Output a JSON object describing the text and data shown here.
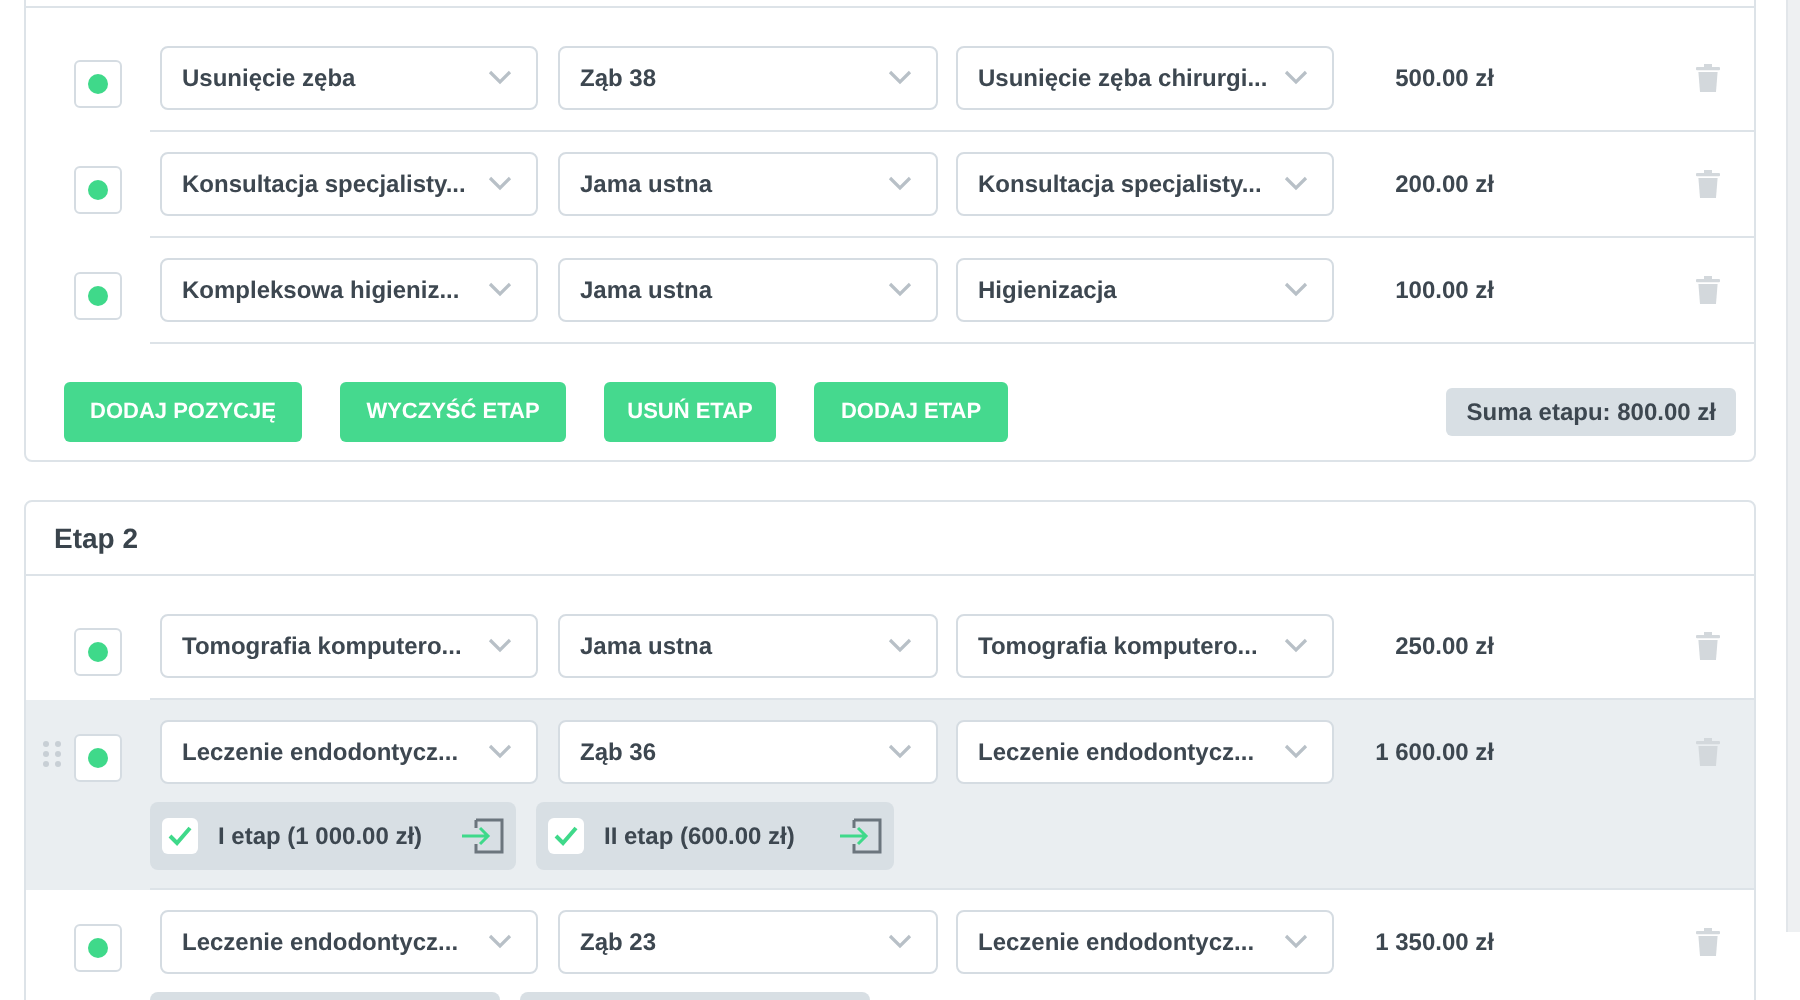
{
  "stages": [
    {
      "rows": [
        {
          "checked": true,
          "highlighted": false,
          "service": "Usunięcie zęba",
          "location": "Ząb 38",
          "variant": "Usunięcie zęba chirurgi...",
          "price": "500.00 zł"
        },
        {
          "checked": true,
          "highlighted": false,
          "service": "Konsultacja specjalisty...",
          "location": "Jama ustna",
          "variant": "Konsultacja specjalisty...",
          "price": "200.00 zł"
        },
        {
          "checked": true,
          "highlighted": false,
          "service": "Kompleksowa higieniz...",
          "location": "Jama ustna",
          "variant": "Higienizacja",
          "price": "100.00 zł"
        }
      ],
      "buttons": [
        "DODAJ POZYCJĘ",
        "WYCZYŚĆ ETAP",
        "USUŃ ETAP",
        "DODAJ ETAP"
      ],
      "total": "Suma etapu: 800.00 zł"
    },
    {
      "title": "Etap 2",
      "rows": [
        {
          "checked": true,
          "highlighted": false,
          "service": "Tomografia komputero...",
          "location": "Jama ustna",
          "variant": "Tomografia komputero...",
          "price": "250.00 zł"
        },
        {
          "checked": true,
          "highlighted": true,
          "service": "Leczenie endodontycz...",
          "location": "Ząb 36",
          "variant": "Leczenie endodontycz...",
          "price": "1 600.00 zł",
          "sub_items": [
            {
              "label": "I etap (1 000.00 zł)",
              "checked": true
            },
            {
              "label": "II etap (600.00 zł)",
              "checked": true
            }
          ]
        },
        {
          "checked": true,
          "highlighted": false,
          "service": "Leczenie endodontycz...",
          "location": "Ząb 23",
          "variant": "Leczenie endodontycz...",
          "price": "1 350.00 zł",
          "sub_items": [
            {
              "cut": true
            },
            {
              "cut": true
            }
          ]
        }
      ]
    }
  ]
}
